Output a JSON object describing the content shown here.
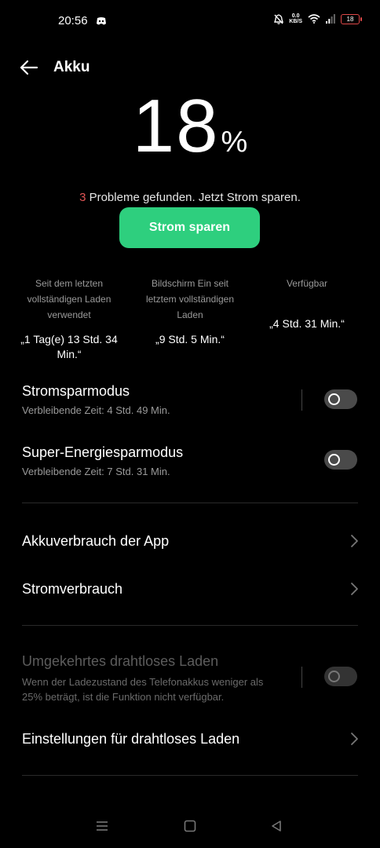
{
  "status_bar": {
    "time": "20:56",
    "net_speed_value": "0.0",
    "net_speed_unit": "KB/S",
    "battery_level": "18"
  },
  "header": {
    "title": "Akku"
  },
  "battery": {
    "percent": "18",
    "percent_sign": "%"
  },
  "problems": {
    "count": "3",
    "text": " Probleme gefunden. Jetzt Strom sparen."
  },
  "save_button": {
    "label": "Strom sparen"
  },
  "stats": [
    {
      "label": "Seit dem letzten vollständigen Laden verwendet",
      "value": "„1 Tag(e) 13 Std. 34 Min.“"
    },
    {
      "label": "Bildschirm Ein seit letztem vollständigen Laden",
      "value": "„9 Std. 5 Min.“"
    },
    {
      "label": "Verfügbar",
      "value": "„4 Std. 31 Min.“"
    }
  ],
  "power_saving": {
    "title": "Stromsparmodus",
    "subtitle": "Verbleibende Zeit:  4 Std. 49 Min.",
    "enabled": false
  },
  "super_saving": {
    "title": "Super-Energiesparmodus",
    "subtitle": "Verbleibende Zeit:  7 Std. 31 Min.",
    "enabled": false
  },
  "app_usage": {
    "title": "Akkuverbrauch der App"
  },
  "power_usage": {
    "title": "Stromverbrauch"
  },
  "reverse_wireless": {
    "title": "Umgekehrtes drahtloses Laden",
    "subtitle": "Wenn der Ladezustand des Telefonakkus weniger als 25% beträgt, ist die Funktion nicht verfügbar.",
    "enabled": false
  },
  "wireless_settings": {
    "title": "Einstellungen für drahtloses Laden"
  },
  "colors": {
    "accent": "#2ecf7e",
    "warning": "#e25555",
    "background": "#000000"
  }
}
